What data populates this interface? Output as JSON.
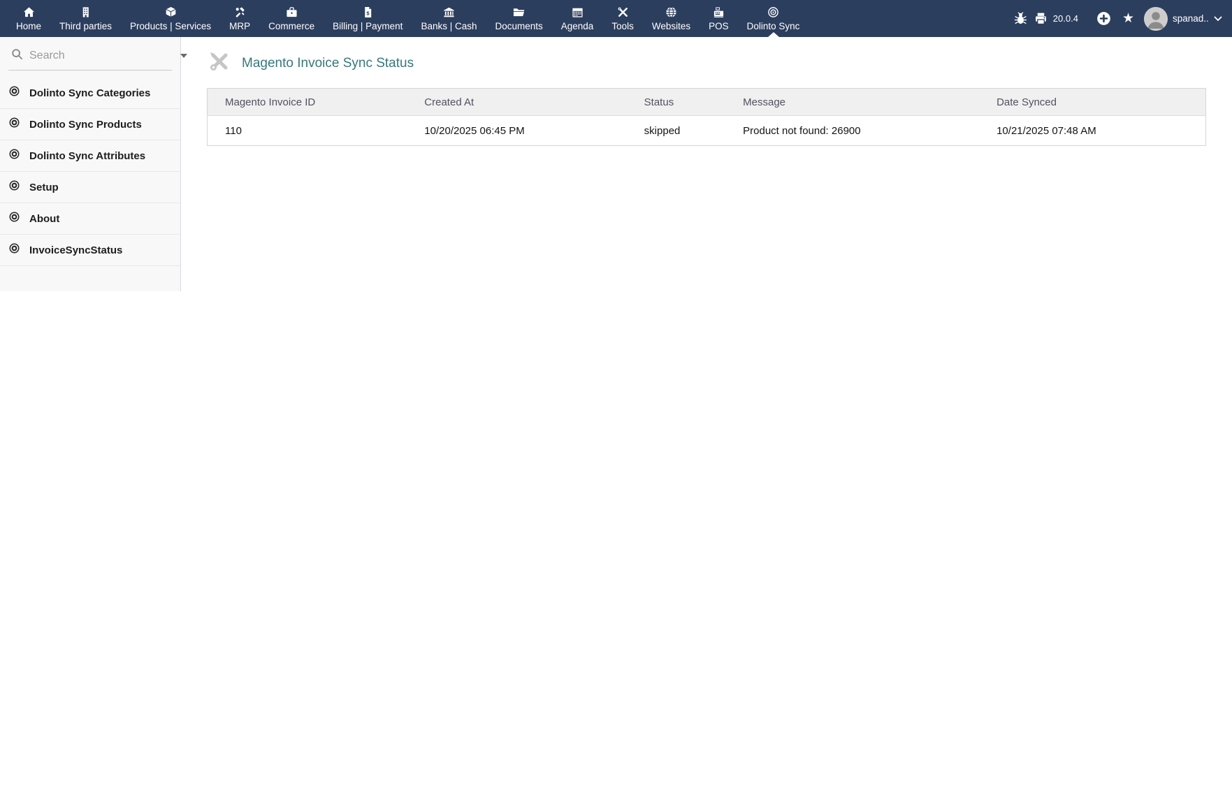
{
  "colors": {
    "topbar_bg": "#2c3e5e",
    "accent_teal": "#36787d",
    "table_header_bg": "#f0f0f1",
    "sidebar_bg": "#f8f8f8"
  },
  "topbar": {
    "items": [
      {
        "label": "Home",
        "icon": "home-icon"
      },
      {
        "label": "Third parties",
        "icon": "building-icon"
      },
      {
        "label": "Products | Services",
        "icon": "cube-icon"
      },
      {
        "label": "MRP",
        "icon": "hammer-icon"
      },
      {
        "label": "Commerce",
        "icon": "briefcase-icon"
      },
      {
        "label": "Billing | Payment",
        "icon": "invoice-icon"
      },
      {
        "label": "Banks | Cash",
        "icon": "bank-icon"
      },
      {
        "label": "Documents",
        "icon": "folder-icon"
      },
      {
        "label": "Agenda",
        "icon": "calendar-icon"
      },
      {
        "label": "Tools",
        "icon": "tools-icon"
      },
      {
        "label": "Websites",
        "icon": "globe-icon"
      },
      {
        "label": "POS",
        "icon": "cash-register-icon"
      },
      {
        "label": "Dolinto Sync",
        "icon": "bullseye-icon",
        "active": true
      }
    ],
    "version": "20.0.4",
    "user": {
      "name": "spanad..."
    }
  },
  "sidebar": {
    "search": {
      "placeholder": "Search"
    },
    "items": [
      {
        "label": "Dolinto Sync Categories"
      },
      {
        "label": "Dolinto Sync Products"
      },
      {
        "label": "Dolinto Sync Attributes"
      },
      {
        "label": "Setup"
      },
      {
        "label": "About"
      },
      {
        "label": "InvoiceSyncStatus"
      }
    ]
  },
  "main": {
    "title": "Magento Invoice Sync Status",
    "table": {
      "columns": [
        "Magento Invoice ID",
        "Created At",
        "Status",
        "Message",
        "Date Synced"
      ],
      "rows": [
        [
          "110",
          "10/20/2025 06:45 PM",
          "skipped",
          "Product not found: 26900",
          "10/21/2025 07:48 AM"
        ]
      ]
    }
  }
}
